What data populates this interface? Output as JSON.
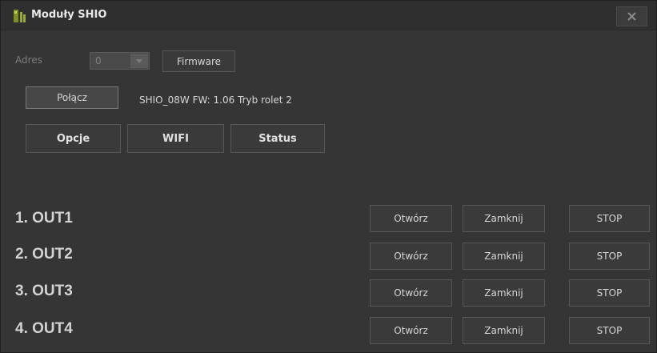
{
  "window": {
    "title": "Moduły SHIO",
    "close_icon": "close-x-icon",
    "app_icon": "shio-logo-icon"
  },
  "address": {
    "label": "Adres",
    "value": "0",
    "firmware_button": "Firmware"
  },
  "connection": {
    "connect_button": "Połącz",
    "device_info": "SHIO_08W  FW: 1.06   Tryb rolet 2"
  },
  "tabs": [
    {
      "label": "Opcje"
    },
    {
      "label": "WIFI"
    },
    {
      "label": "Status"
    }
  ],
  "outputs": [
    {
      "label": "1. OUT1",
      "open": "Otwórz",
      "close": "Zamknij",
      "stop": "STOP"
    },
    {
      "label": "2. OUT2",
      "open": "Otwórz",
      "close": "Zamknij",
      "stop": "STOP"
    },
    {
      "label": "3. OUT3",
      "open": "Otwórz",
      "close": "Zamknij",
      "stop": "STOP"
    },
    {
      "label": "4. OUT4",
      "open": "Otwórz",
      "close": "Zamknij",
      "stop": "STOP"
    }
  ],
  "colors": {
    "background": "#353535",
    "titlebar": "#2f2f2f",
    "button": "#3a3a3a",
    "text": "#d6d6d6",
    "icon_green": "#8a9a2a"
  }
}
